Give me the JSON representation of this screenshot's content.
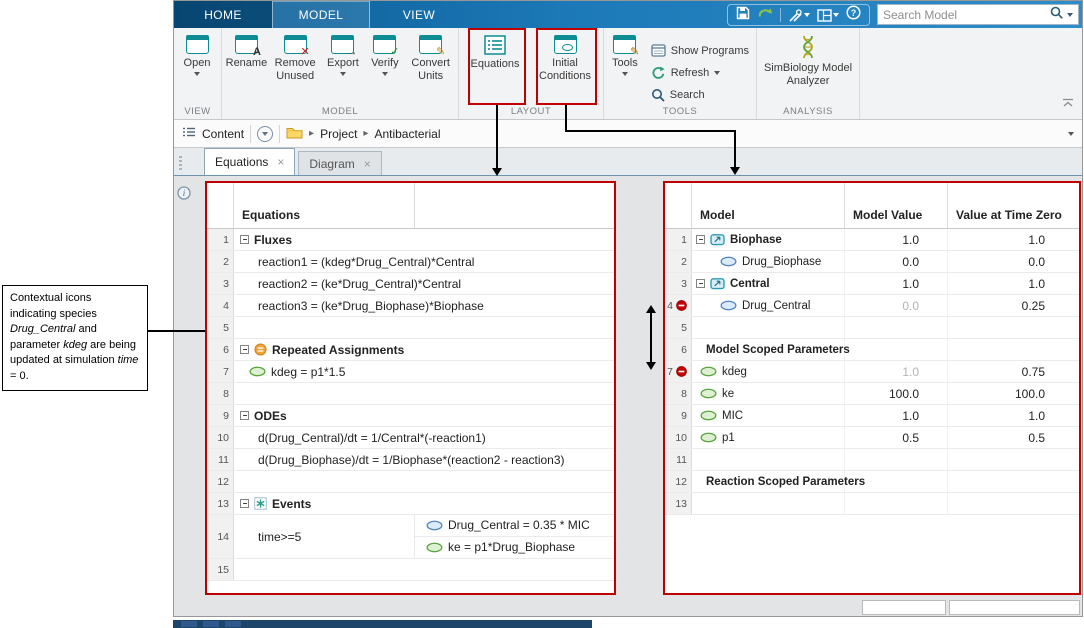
{
  "window": {
    "titlebar": {
      "tabs": {
        "home": "HOME",
        "model": "MODEL",
        "view": "VIEW"
      },
      "search": {
        "placeholder": "Search Model"
      }
    },
    "ribbon": {
      "sections": {
        "view": "VIEW",
        "model": "MODEL",
        "layout": "LAYOUT",
        "tools": "TOOLS",
        "analysis": "ANALYSIS"
      },
      "buttons": {
        "open": "Open",
        "rename": "Rename",
        "remove_unused": "Remove Unused",
        "export": "Export",
        "verify": "Verify",
        "convert_units": "Convert Units",
        "equations": "Equations",
        "initial_conditions": "Initial Conditions",
        "tools": "Tools",
        "show_programs": "Show Programs",
        "refresh": "Refresh",
        "search": "Search",
        "simbiology_analyzer": "SimBiology Model Analyzer"
      }
    },
    "pathbar": {
      "content": "Content",
      "project": "Project",
      "model_name": "Antibacterial"
    },
    "doc_tabs": {
      "equations": "Equations",
      "diagram": "Diagram",
      "close_glyph": "×"
    }
  },
  "equations_table": {
    "header": "Equations",
    "rows": [
      {
        "num": "1",
        "text": "Fluxes",
        "kind": "section"
      },
      {
        "num": "2",
        "text": "reaction1 = (kdeg*Drug_Central)*Central",
        "kind": "equation"
      },
      {
        "num": "3",
        "text": "reaction2 = (ke*Drug_Central)*Central",
        "kind": "equation"
      },
      {
        "num": "4",
        "text": "reaction3 = (ke*Drug_Biophase)*Biophase",
        "kind": "equation"
      },
      {
        "num": "5",
        "text": "",
        "kind": "empty"
      },
      {
        "num": "6",
        "text": "Repeated Assignments",
        "kind": "section",
        "icon": "repeated-assignment-icon"
      },
      {
        "num": "7",
        "text": "kdeg = p1*1.5",
        "kind": "assignment",
        "icon": "parameter-icon"
      },
      {
        "num": "8",
        "text": "",
        "kind": "empty"
      },
      {
        "num": "9",
        "text": "ODEs",
        "kind": "section"
      },
      {
        "num": "10",
        "text": "d(Drug_Central)/dt = 1/Central*(-reaction1)",
        "kind": "equation"
      },
      {
        "num": "11",
        "text": "d(Drug_Biophase)/dt = 1/Biophase*(reaction2 - reaction3)",
        "kind": "equation"
      },
      {
        "num": "12",
        "text": "",
        "kind": "empty"
      },
      {
        "num": "13",
        "text": "Events",
        "kind": "section",
        "icon": "event-icon"
      },
      {
        "num": "14",
        "condition": "time>=5",
        "assign1": "Drug_Central = 0.35 * MIC",
        "assign2": "ke = p1*Drug_Biophase",
        "kind": "event"
      },
      {
        "num": "15",
        "text": "",
        "kind": "empty"
      }
    ]
  },
  "model_table": {
    "headers": {
      "model": "Model",
      "model_value": "Model Value",
      "value_at_time_zero": "Value at Time Zero"
    },
    "rows": [
      {
        "num": "1",
        "name": "Biophase",
        "model_value": "1.0",
        "value_at_time_zero": "1.0",
        "kind": "compartment"
      },
      {
        "num": "2",
        "name": "Drug_Biophase",
        "model_value": "0.0",
        "value_at_time_zero": "0.0",
        "kind": "species"
      },
      {
        "num": "3",
        "name": "Central",
        "model_value": "1.0",
        "value_at_time_zero": "1.0",
        "kind": "compartment"
      },
      {
        "num": "4",
        "name": "Drug_Central",
        "model_value": "0.0",
        "value_at_time_zero": "0.25",
        "kind": "species",
        "model_value_muted": true,
        "gutter_icon": "updated-at-time-zero-icon"
      },
      {
        "num": "5",
        "name": "",
        "model_value": "",
        "value_at_time_zero": "",
        "kind": "empty"
      },
      {
        "num": "6",
        "name": "Model Scoped Parameters",
        "model_value": "",
        "value_at_time_zero": "",
        "kind": "group"
      },
      {
        "num": "7",
        "name": "kdeg",
        "model_value": "1.0",
        "value_at_time_zero": "0.75",
        "kind": "parameter",
        "model_value_muted": true,
        "gutter_icon": "updated-at-time-zero-icon"
      },
      {
        "num": "8",
        "name": "ke",
        "model_value": "100.0",
        "value_at_time_zero": "100.0",
        "kind": "parameter"
      },
      {
        "num": "9",
        "name": "MIC",
        "model_value": "1.0",
        "value_at_time_zero": "1.0",
        "kind": "parameter"
      },
      {
        "num": "10",
        "name": "p1",
        "model_value": "0.5",
        "value_at_time_zero": "0.5",
        "kind": "parameter"
      },
      {
        "num": "11",
        "name": "",
        "model_value": "",
        "value_at_time_zero": "",
        "kind": "empty"
      },
      {
        "num": "12",
        "name": "Reaction Scoped Parameters",
        "model_value": "",
        "value_at_time_zero": "",
        "kind": "group"
      },
      {
        "num": "13",
        "name": "",
        "model_value": "",
        "value_at_time_zero": "",
        "kind": "empty"
      }
    ]
  },
  "callout": {
    "seg1": "Contextual icons indicating species ",
    "seg2": "Drug_Central",
    "seg3": " and parameter ",
    "seg4": "kdeg",
    "seg5": " are being updated at simulation ",
    "seg6": "time",
    "seg7": " = 0."
  },
  "colors": {
    "annotation_red": "#c00000",
    "titlebar_blue": "#1e79b8",
    "ribbon_icon_teal": "#0d8c94",
    "species_blue": "#4d82c4",
    "parameter_green": "#55a33b",
    "muted_value_gray": "#b3b3b3"
  },
  "icons": {
    "titlebar": [
      "save-icon",
      "undo-icon",
      "tools-icon",
      "layout-icon",
      "help-icon",
      "search-icon"
    ],
    "pathbar": [
      "content-list-icon",
      "recent-folders-icon",
      "folder-icon",
      "breadcrumb-arrow-icon"
    ],
    "tables": [
      "compartment-icon",
      "species-icon",
      "parameter-icon",
      "repeated-assignment-icon",
      "event-icon",
      "updated-at-time-zero-icon",
      "expander-icon"
    ]
  }
}
